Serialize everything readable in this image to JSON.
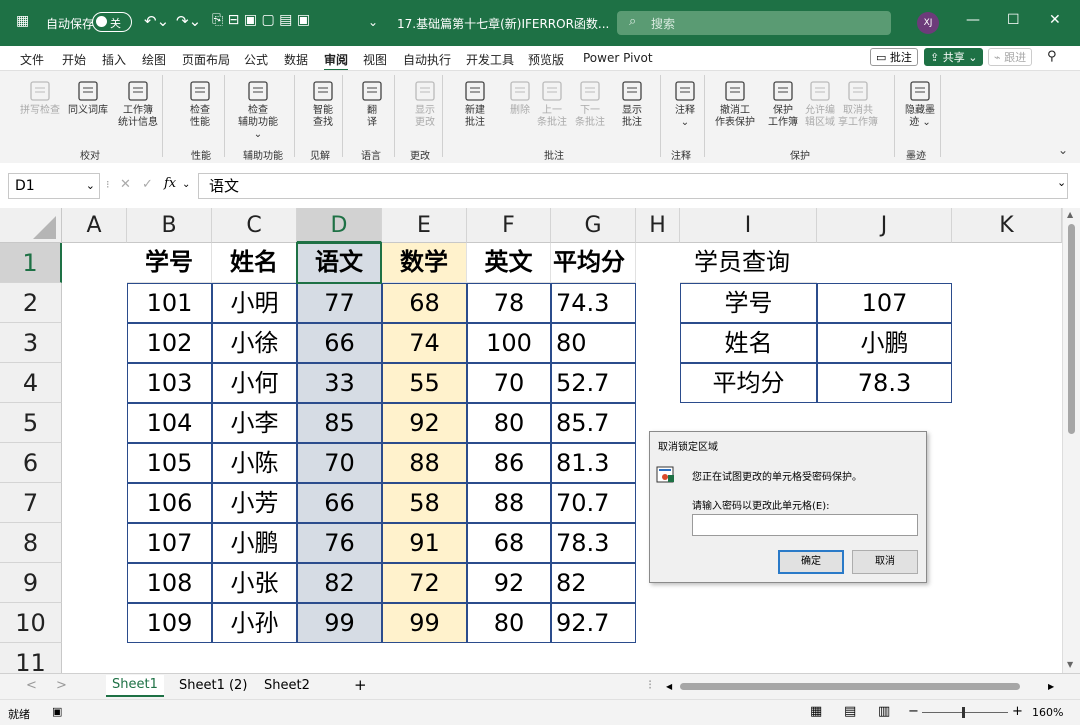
{
  "titlebar": {
    "autosave_label": "自动保存",
    "autosave_state": "关",
    "filename": "17.基础篇第十七章(新)IFERROR函数...",
    "search_placeholder": "搜索",
    "user_initials": "XJ",
    "accent": "#1e7145"
  },
  "menu": {
    "items": [
      "文件",
      "开始",
      "插入",
      "绘图",
      "页面布局",
      "公式",
      "数据",
      "审阅",
      "视图",
      "自动执行",
      "开发工具",
      "预览版",
      "Power Pivot"
    ],
    "active": "审阅",
    "comments_btn": "批注",
    "share_btn": "共享",
    "follow_btn": "跟进"
  },
  "ribbon": {
    "buttons": [
      {
        "label": "拼写检查",
        "icon": "spellcheck-icon",
        "enabled": false
      },
      {
        "label": "同义词库",
        "icon": "thesaurus-icon",
        "enabled": true
      },
      {
        "label": "工作簿\n统计信息",
        "icon": "workbook-stats-icon",
        "enabled": true
      },
      {
        "label": "检查\n性能",
        "icon": "check-performance-icon",
        "enabled": true
      },
      {
        "label": "检查\n辅助功能 ⌄",
        "icon": "accessibility-icon",
        "enabled": true
      },
      {
        "label": "智能\n查找",
        "icon": "smart-lookup-icon",
        "enabled": true
      },
      {
        "label": "翻\n译",
        "icon": "translate-icon",
        "enabled": true
      },
      {
        "label": "显示\n更改",
        "icon": "show-changes-icon",
        "enabled": false
      },
      {
        "label": "新建\n批注",
        "icon": "new-comment-icon",
        "enabled": true
      },
      {
        "label": "删除",
        "icon": "delete-comment-icon",
        "enabled": false
      },
      {
        "label": "上一\n条批注",
        "icon": "previous-comment-icon",
        "enabled": false
      },
      {
        "label": "下一\n条批注",
        "icon": "next-comment-icon",
        "enabled": false
      },
      {
        "label": "显示\n批注",
        "icon": "show-comments-icon",
        "enabled": true
      },
      {
        "label": "注释\n⌄",
        "icon": "notes-icon",
        "enabled": true
      },
      {
        "label": "撤消工\n作表保护",
        "icon": "unprotect-sheet-icon",
        "enabled": true
      },
      {
        "label": "保护\n工作簿",
        "icon": "protect-workbook-icon",
        "enabled": true
      },
      {
        "label": "允许编\n辑区域",
        "icon": "allow-edit-ranges-icon",
        "enabled": false
      },
      {
        "label": "取消共\n享工作簿",
        "icon": "unshare-workbook-icon",
        "enabled": false
      },
      {
        "label": "隐藏墨\n迹 ⌄",
        "icon": "hide-ink-icon",
        "enabled": true
      }
    ],
    "groups": [
      "校对",
      "性能",
      "辅助功能",
      "见解",
      "语言",
      "更改",
      "批注",
      "注释",
      "保护",
      "墨迹"
    ]
  },
  "formula": {
    "namebox": "D1",
    "fx": "fx",
    "content": "语文"
  },
  "grid": {
    "columns": [
      "A",
      "B",
      "C",
      "D",
      "E",
      "F",
      "G",
      "H",
      "I",
      "J",
      "K"
    ],
    "selected_column": "D",
    "rows": [
      "1",
      "2",
      "3",
      "4",
      "5",
      "6",
      "7",
      "8",
      "9",
      "10",
      "11"
    ],
    "table_headers": [
      "学号",
      "姓名",
      "语文",
      "数学",
      "英文",
      "平均分"
    ],
    "table_rows": [
      [
        "101",
        "小明",
        "77",
        "68",
        "78",
        "74.3"
      ],
      [
        "102",
        "小徐",
        "66",
        "74",
        "100",
        "80"
      ],
      [
        "103",
        "小何",
        "33",
        "55",
        "70",
        "52.7"
      ],
      [
        "104",
        "小李",
        "85",
        "92",
        "80",
        "85.7"
      ],
      [
        "105",
        "小陈",
        "70",
        "88",
        "86",
        "81.3"
      ],
      [
        "106",
        "小芳",
        "66",
        "58",
        "88",
        "70.7"
      ],
      [
        "107",
        "小鹏",
        "76",
        "91",
        "68",
        "78.3"
      ],
      [
        "108",
        "小张",
        "82",
        "72",
        "92",
        "82"
      ],
      [
        "109",
        "小孙",
        "99",
        "99",
        "80",
        "92.7"
      ]
    ],
    "lookup_title": "学员查询",
    "lookup": [
      {
        "label": "学号",
        "value": "107"
      },
      {
        "label": "姓名",
        "value": "小鹏"
      },
      {
        "label": "平均分",
        "value": "78.3"
      }
    ],
    "chinese_col_fill": "#d6dce4",
    "math_col_fill": "#fff2cc"
  },
  "dialog": {
    "title": "取消锁定区域",
    "message": "您正在试图更改的单元格受密码保护。",
    "prompt": "请输入密码以更改此单元格(E):",
    "password_value": "",
    "ok": "确定",
    "cancel": "取消"
  },
  "sheets": {
    "tabs": [
      "Sheet1",
      "Sheet1 (2)",
      "Sheet2"
    ],
    "active": "Sheet1"
  },
  "status": {
    "mode": "就绪",
    "zoom": "160%"
  }
}
